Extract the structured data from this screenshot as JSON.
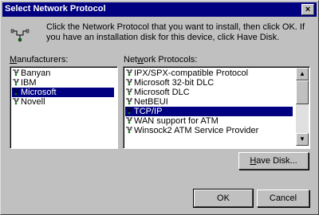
{
  "window": {
    "title": "Select Network Protocol",
    "close_glyph": "×"
  },
  "instructions": "Click the Network Protocol that you want to install, then click OK. If you have an installation disk for this device, click Have Disk.",
  "manufacturers": {
    "label_prefix": "",
    "label_accel": "M",
    "label_rest": "anufacturers:",
    "items": [
      "Banyan",
      "IBM",
      "Microsoft",
      "Novell"
    ],
    "selected": "Microsoft"
  },
  "protocols": {
    "label_prefix": "Net",
    "label_accel": "w",
    "label_rest": "ork Protocols:",
    "items": [
      "IPX/SPX-compatible Protocol",
      "Microsoft 32-bit DLC",
      "Microsoft DLC",
      "NetBEUI",
      "TCP/IP",
      "WAN support for ATM",
      "Winsock2 ATM Service Provider"
    ],
    "selected": "TCP/IP"
  },
  "buttons": {
    "have_disk_accel": "H",
    "have_disk_rest": "ave Disk...",
    "ok": "OK",
    "cancel": "Cancel"
  },
  "colors": {
    "face": "#c0c0c0",
    "titlebar": "#000080",
    "selection": "#000080"
  },
  "icons": {
    "header": "network-protocol-icon",
    "item": "protocol-icon"
  }
}
